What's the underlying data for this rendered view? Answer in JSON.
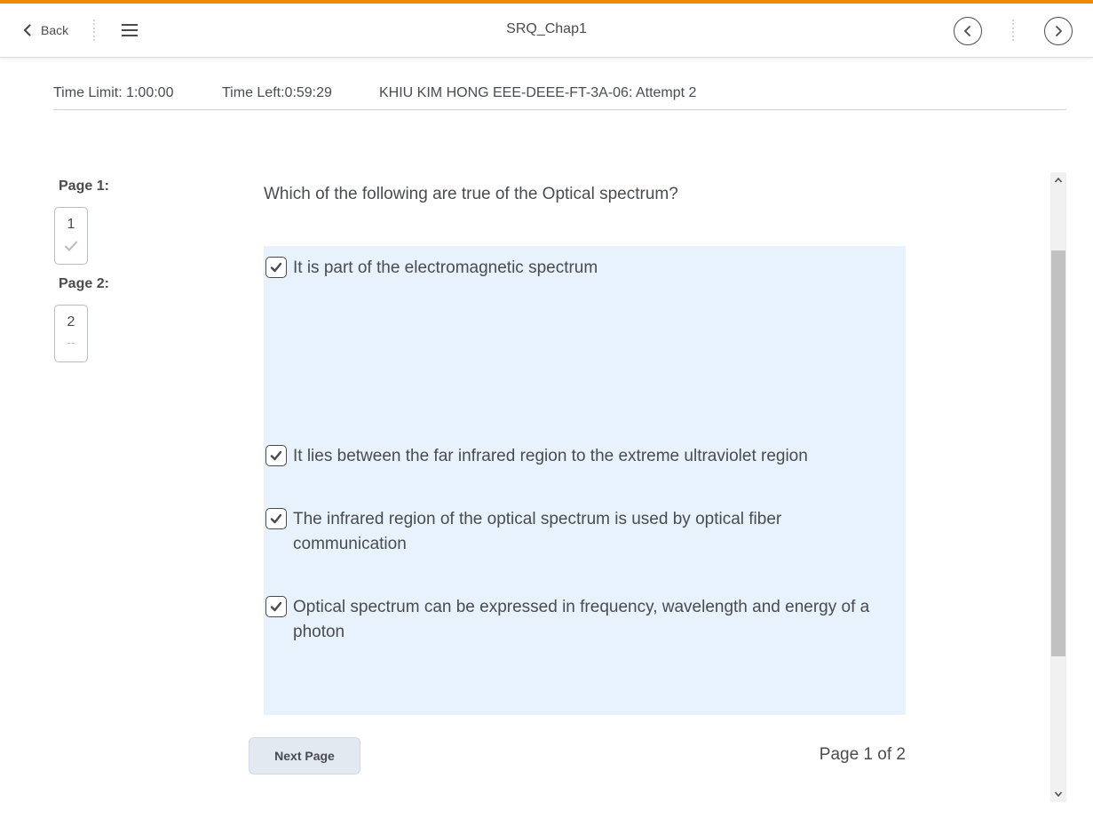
{
  "nav": {
    "back_label": "Back",
    "title": "SRQ_Chap1",
    "accent_color": "#f18a00"
  },
  "info": {
    "time_limit": "Time Limit: 1:00:00",
    "time_left": "Time Left:0:59:29",
    "attempt": "KHIU KIM HONG EEE-DEEE-FT-3A-06: Attempt 2"
  },
  "sidebar": {
    "pages": [
      {
        "label": "Page 1:",
        "number": "1",
        "status_icon": "check-icon",
        "status": "answered"
      },
      {
        "label": "Page 2:",
        "number": "2",
        "status_icon": "dash",
        "status_text": "--",
        "status": "unanswered"
      }
    ]
  },
  "question": {
    "text": "Which of the following are true of the Optical spectrum?",
    "options": [
      {
        "text": "It is part of the electromagnetic spectrum",
        "checked": true
      },
      {
        "text": "It lies between the far infrared region to the extreme ultraviolet region",
        "checked": true
      },
      {
        "text": "The infrared region of the optical spectrum is used by optical fiber communication",
        "checked": true
      },
      {
        "text": "Optical spectrum can be expressed in frequency, wavelength and energy of a photon",
        "checked": true
      }
    ],
    "panel_color": "#e8f2fc"
  },
  "footer": {
    "next_label": "Next Page",
    "page_count": "Page 1 of 2"
  }
}
